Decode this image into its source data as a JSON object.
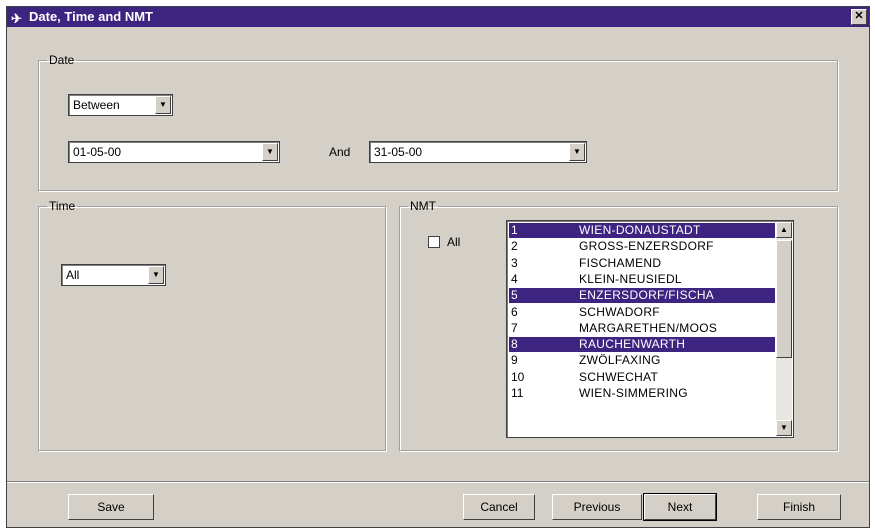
{
  "window": {
    "title": "Date, Time and NMT",
    "close_glyph": "✕"
  },
  "date": {
    "legend": "Date",
    "mode": "Between",
    "from": "01-05-00",
    "and_label": "And",
    "to": "31-05-00"
  },
  "time": {
    "legend": "Time",
    "value": "All"
  },
  "nmt": {
    "legend": "NMT",
    "all_label": "All",
    "all_checked": false,
    "items": [
      {
        "num": "1",
        "name": "WIEN-DONAUSTADT",
        "selected": true
      },
      {
        "num": "2",
        "name": "GROSS-ENZERSDORF",
        "selected": false
      },
      {
        "num": "3",
        "name": "FISCHAMEND",
        "selected": false
      },
      {
        "num": "4",
        "name": "KLEIN-NEUSIEDL",
        "selected": false
      },
      {
        "num": "5",
        "name": "ENZERSDORF/FISCHA",
        "selected": true
      },
      {
        "num": "6",
        "name": "SCHWADORF",
        "selected": false
      },
      {
        "num": "7",
        "name": "MARGARETHEN/MOOS",
        "selected": false
      },
      {
        "num": "8",
        "name": "RAUCHENWARTH",
        "selected": true
      },
      {
        "num": "9",
        "name": "ZWÖLFAXING",
        "selected": false
      },
      {
        "num": "10",
        "name": "SCHWECHAT",
        "selected": false
      },
      {
        "num": "11",
        "name": "WIEN-SIMMERING",
        "selected": false
      }
    ]
  },
  "buttons": {
    "save": "Save",
    "cancel": "Cancel",
    "previous": "Previous",
    "next": "Next",
    "finish": "Finish"
  },
  "icons": {
    "app": "airplane-icon",
    "dropdown": "chevron-down-icon",
    "scroll_up": "scroll-up-icon",
    "scroll_down": "scroll-down-icon"
  },
  "colors": {
    "titlebar": "#3c2480",
    "selection": "#3c2480",
    "face": "#d4d0c8"
  }
}
